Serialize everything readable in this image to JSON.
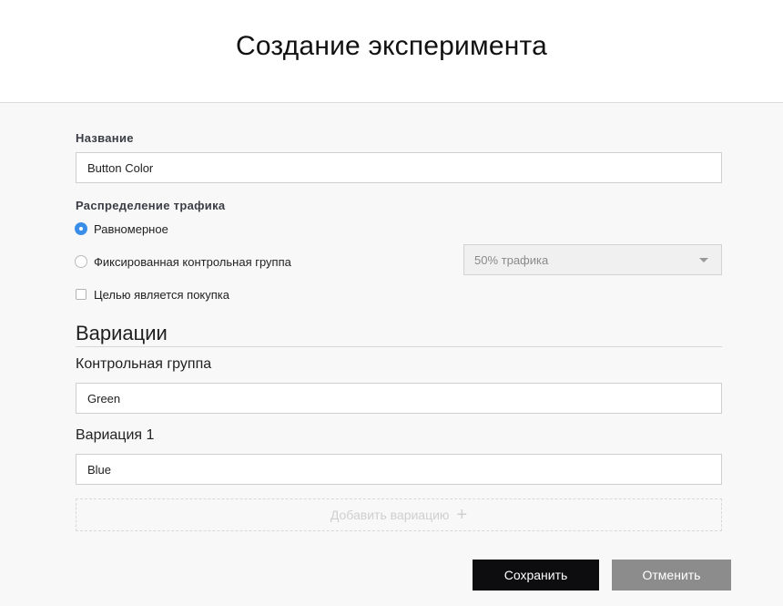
{
  "header": {
    "title": "Создание эксперимента"
  },
  "form": {
    "name_label": "Название",
    "name_value": "Button Color",
    "traffic_label": "Распределение трафика",
    "traffic_options": [
      {
        "label": "Равномерное",
        "selected": true
      },
      {
        "label": "Фиксированная контрольная группа",
        "selected": false
      }
    ],
    "traffic_select_value": "50% трафика",
    "purchase_goal_label": "Целью является покупка",
    "purchase_goal_checked": false
  },
  "variations": {
    "title": "Вариации",
    "control_label": "Контрольная группа",
    "control_value": "Green",
    "variation1_label": "Вариация 1",
    "variation1_value": "Blue",
    "add_label": "Добавить вариацию"
  },
  "actions": {
    "save_label": "Сохранить",
    "cancel_label": "Отменить"
  },
  "colors": {
    "accent": "#3b8ee8",
    "save_bg": "#0d0d0f",
    "cancel_bg": "#8c8c8c"
  }
}
